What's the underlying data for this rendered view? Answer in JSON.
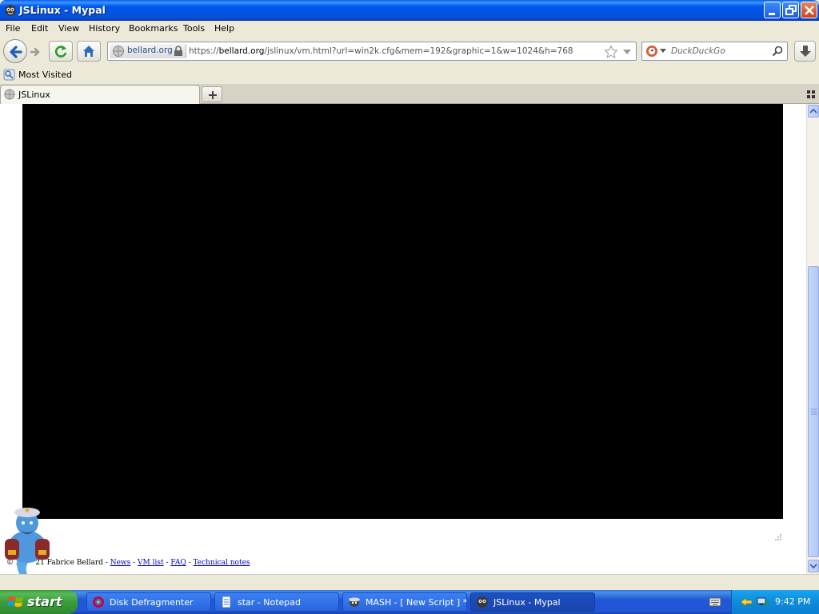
{
  "window": {
    "title": "JSLinux - Mypal"
  },
  "menu": {
    "items": [
      {
        "label": "File"
      },
      {
        "label": "Edit"
      },
      {
        "label": "View"
      },
      {
        "label": "History"
      },
      {
        "label": "Bookmarks"
      },
      {
        "label": "Tools"
      },
      {
        "label": "Help"
      }
    ]
  },
  "nav": {
    "identity_label": "bellard.org",
    "url_prefix": "https://",
    "url_host": "bellard.org",
    "url_path": "/jslinux/vm.html?url=win2k.cfg&mem=192&graphic=1&w=1024&h=768",
    "search_placeholder": "DuckDuckGo"
  },
  "bookmarks": {
    "most_visited": "Most Visited"
  },
  "tabs": [
    {
      "label": "JSLinux"
    }
  ],
  "page": {
    "footer": {
      "copyright": "© 20",
      "copyright_rest": "21 Fabrice Bellard -",
      "links": [
        "News",
        "VM list",
        "FAQ",
        "Technical notes"
      ]
    }
  },
  "taskbar": {
    "start_label": "start",
    "items": [
      {
        "label": "Disk Defragmenter",
        "icon": "defrag-icon"
      },
      {
        "label": "star - Notepad",
        "icon": "notepad-icon"
      },
      {
        "label": "MASH - [ New Script ] *",
        "icon": "mash-icon"
      },
      {
        "label": "JSLinux - Mypal",
        "icon": "mypal-icon",
        "active": true
      }
    ],
    "clock": "9:42 PM"
  },
  "colors": {
    "titlebar": "#0054e3",
    "taskbar": "#2157d7",
    "start": "#3c9c3c",
    "tray": "#0d8bd9",
    "vm_screen": "#000000"
  }
}
